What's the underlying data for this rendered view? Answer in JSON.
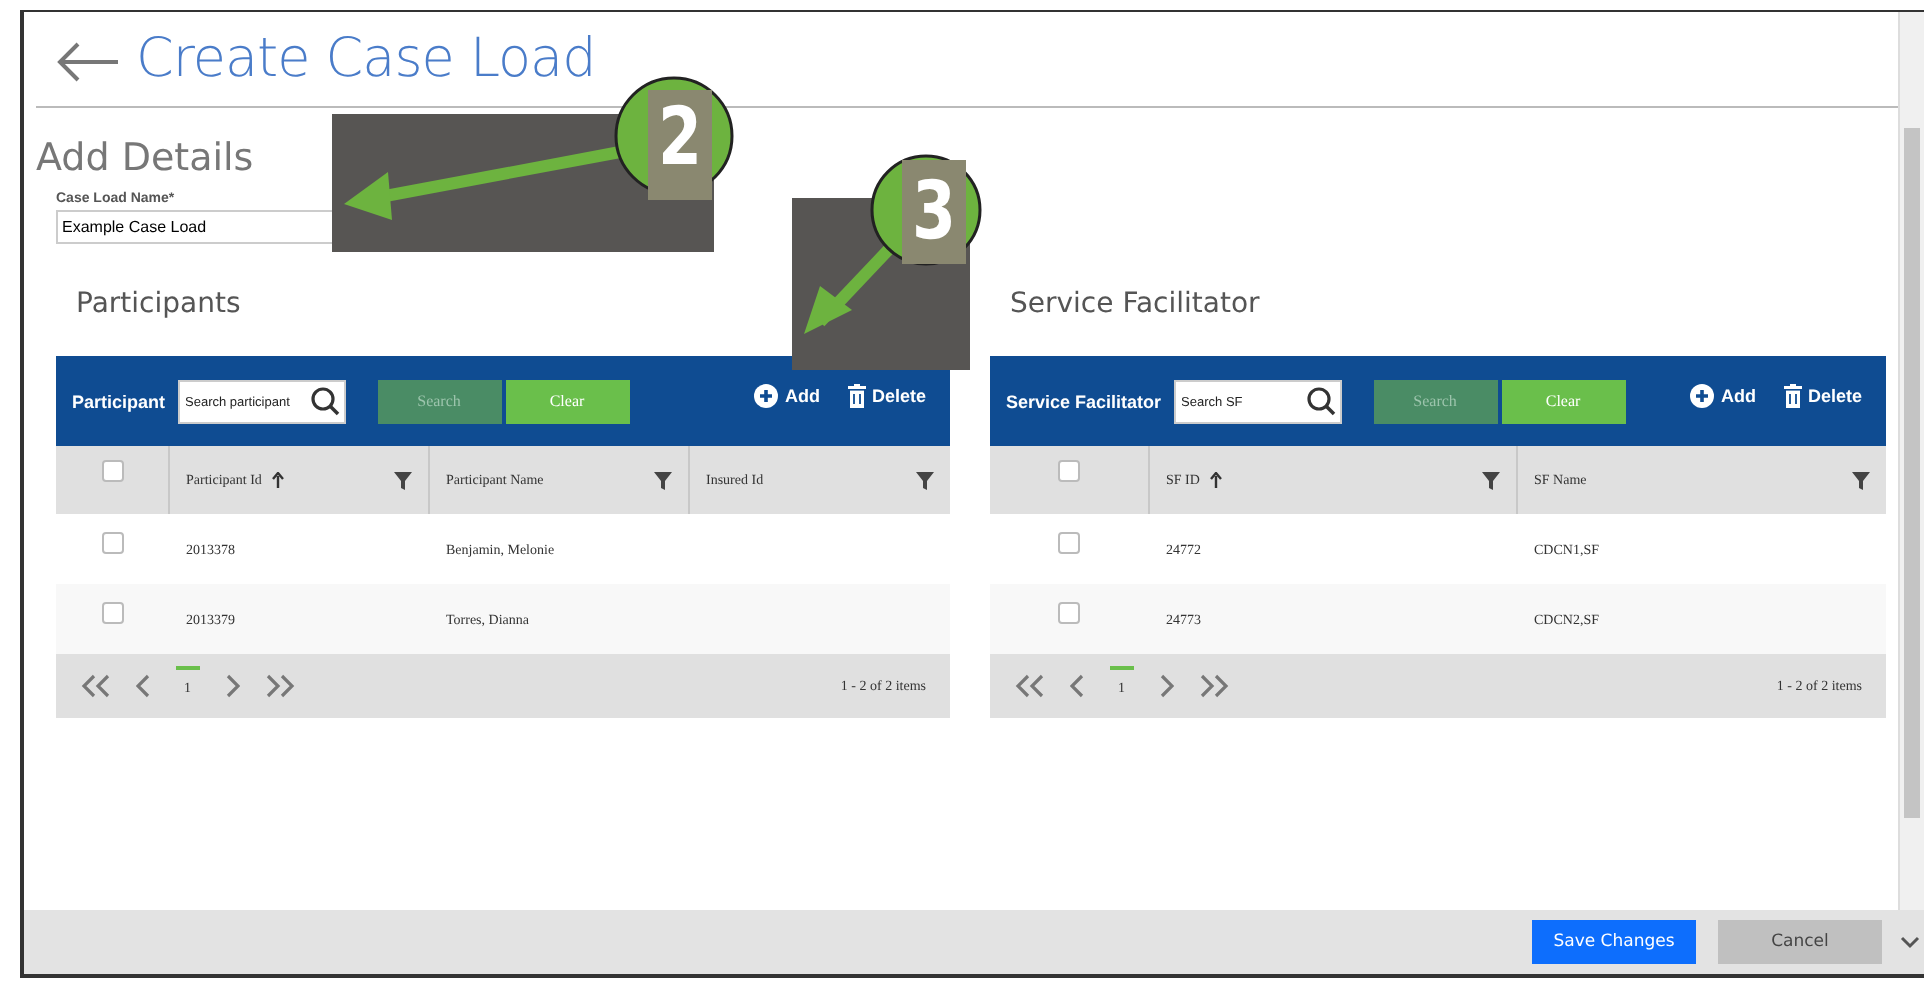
{
  "page": {
    "title": "Create Case Load",
    "section": "Add Details"
  },
  "case_load_name": {
    "label": "Case Load Name*",
    "value": "Example Case Load"
  },
  "panels": [
    {
      "title": "Participants",
      "toolbar_label": "Participant",
      "search": {
        "placeholder": "Search participant"
      },
      "search_button": {
        "label": "Search",
        "disabled": true
      },
      "clear_button": {
        "label": "Clear"
      },
      "add_button": {
        "label": "Add"
      },
      "delete_button": {
        "label": "Delete"
      },
      "header_checkbox": {
        "checked": false
      },
      "columns": [
        {
          "label": "Participant Id",
          "sorted": true
        },
        {
          "label": "Participant Name",
          "sorted": false
        },
        {
          "label": "Insured Id",
          "sorted": false
        }
      ],
      "rows": [
        {
          "checked": false,
          "cells": [
            "2013378",
            "Benjamin, Melonie"
          ]
        },
        {
          "checked": false,
          "cells": [
            "2013379",
            "Torres, Dianna"
          ]
        }
      ],
      "pager": {
        "pages": [
          {
            "label": "1",
            "selected": true
          }
        ],
        "summary": "1 - 2 of 2 items"
      }
    },
    {
      "title": "Service Facilitator",
      "toolbar_label": "Service Facilitator",
      "search": {
        "placeholder": "Search SF"
      },
      "search_button": {
        "label": "Search",
        "disabled": true
      },
      "clear_button": {
        "label": "Clear"
      },
      "add_button": {
        "label": "Add"
      },
      "delete_button": {
        "label": "Delete"
      },
      "header_checkbox": {
        "checked": false
      },
      "columns": [
        {
          "label": "SF ID",
          "sorted": true
        },
        {
          "label": "SF Name",
          "sorted": false
        }
      ],
      "rows": [
        {
          "checked": false,
          "cells": [
            "24772",
            "CDCN1,SF"
          ]
        },
        {
          "checked": false,
          "cells": [
            "24773",
            "CDCN2,SF"
          ]
        }
      ],
      "pager": {
        "pages": [
          {
            "label": "1",
            "selected": true
          }
        ],
        "summary": "1 - 2 of 2 items"
      }
    }
  ],
  "footer": {
    "save": "Save Changes",
    "cancel": "Cancel"
  },
  "callouts": [
    {
      "number": "2"
    },
    {
      "number": "3"
    }
  ]
}
